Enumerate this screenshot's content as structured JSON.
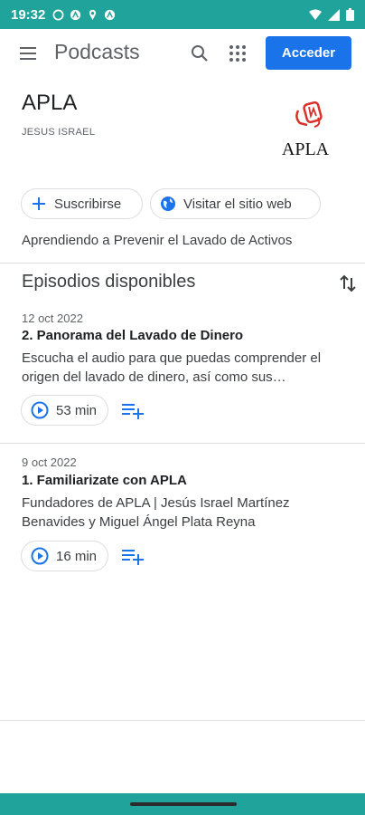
{
  "status_bar": {
    "time": "19:32",
    "color": "#1fa39a"
  },
  "app_bar": {
    "title": "Podcasts",
    "login_label": "Acceder"
  },
  "podcast": {
    "title": "APLA",
    "author": "JESUS ISRAEL",
    "cover_text": "APLA",
    "subscribe_label": "Suscribirse",
    "website_label": "Visitar el sitio web",
    "description": "Aprendiendo a Prevenir el Lavado de Activos"
  },
  "episodes_section": {
    "title": "Episodios disponibles"
  },
  "episodes": [
    {
      "date": "12 oct 2022",
      "title": "2. Panorama del Lavado de Dinero",
      "description": "Escucha el audio para que puedas comprender el origen del lavado de dinero, así como sus…",
      "duration": "53 min"
    },
    {
      "date": "9 oct 2022",
      "title": "1. Familiarizate con APLA",
      "description": "Fundadores de APLA | Jesús Israel Martínez Benavides y Miguel Ángel Plata Reyna",
      "duration": "16 min"
    }
  ],
  "colors": {
    "accent": "#1a73e8",
    "system_bar": "#1fa39a"
  }
}
